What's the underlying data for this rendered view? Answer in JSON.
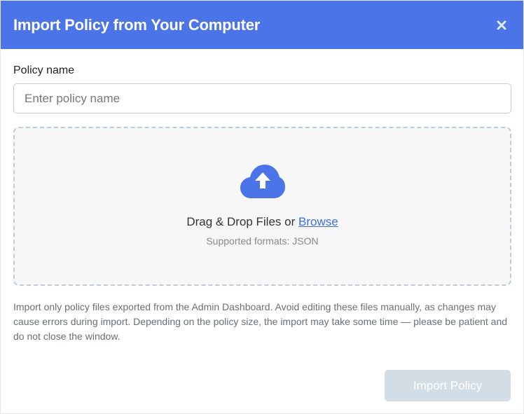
{
  "dialog": {
    "title": "Import Policy from Your Computer",
    "close_icon": "close-icon"
  },
  "form": {
    "policy_name_label": "Policy name",
    "policy_name_placeholder": "Enter policy name",
    "policy_name_value": ""
  },
  "dropzone": {
    "icon": "cloud-upload-icon",
    "text_prefix": "Drag & Drop Files or",
    "browse_label": "Browse",
    "formats": "Supported formats: JSON"
  },
  "help_text": "Import only policy files exported from the Admin Dashboard. Avoid editing these files manually, as changes may cause errors during import. Depending on the policy size, the import may take some time — please be patient and do not close the window.",
  "footer": {
    "import_button_label": "Import Policy",
    "import_button_enabled": false
  },
  "colors": {
    "header": "#4a74e7",
    "accent": "#3d6fe0",
    "button_disabled": "#d3dde6"
  }
}
